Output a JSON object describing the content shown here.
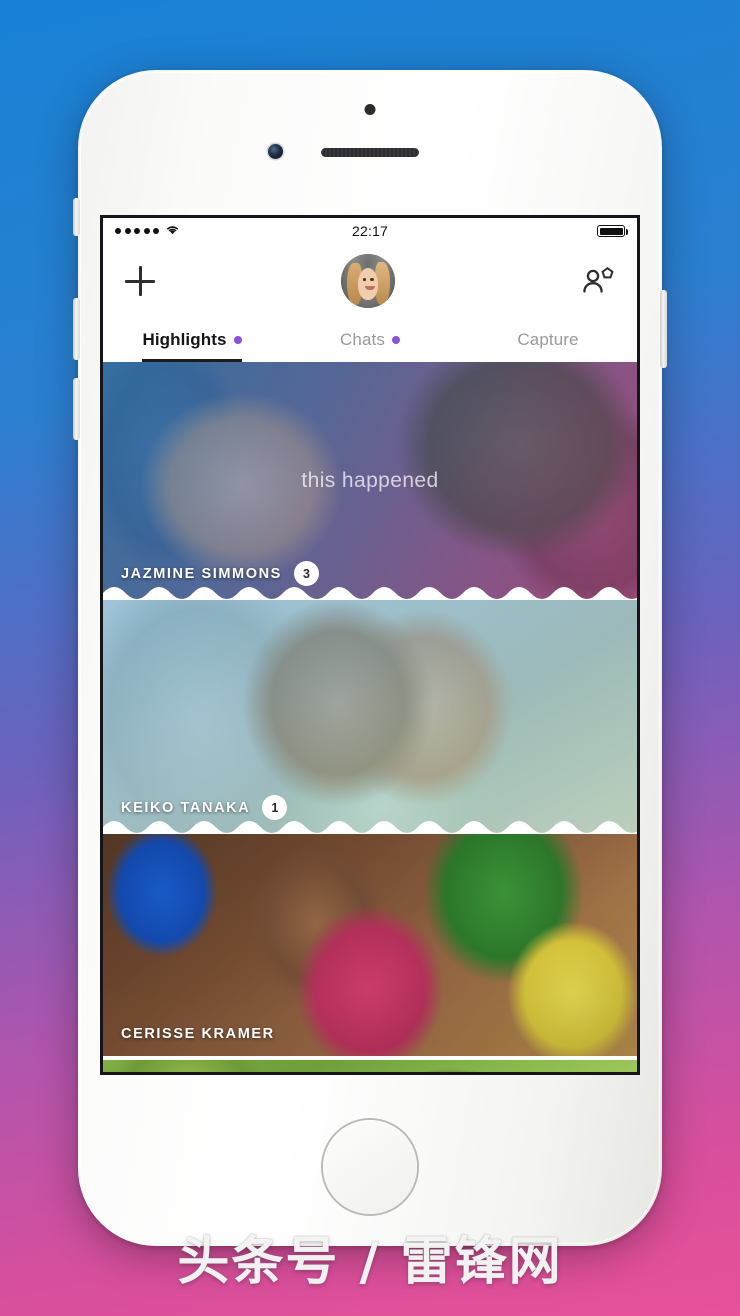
{
  "background": {
    "gradient_top": "#1982d6",
    "gradient_mid": "#6a62bd",
    "gradient_bottom": "#e8509a"
  },
  "watermark": {
    "text": "头条号 / 雷锋网"
  },
  "phone": {
    "device": "white-iphone",
    "hardware": {
      "earpiece": "speaker-grille",
      "front_camera": "camera-icon",
      "proximity_sensor": "sensor-dot",
      "home_button": "home-button"
    }
  },
  "statusbar": {
    "signal_dots": 5,
    "wifi_icon": "wifi-icon",
    "time": "22:17",
    "battery_icon": "battery-full-icon"
  },
  "navbar": {
    "add_label": "+",
    "add_icon": "plus-icon",
    "avatar_icon": "user-avatar",
    "friends_icon": "add-friend-icon"
  },
  "tabs": [
    {
      "label": "Highlights",
      "active": true,
      "has_dot": true,
      "dot_color": "#8c4fd8"
    },
    {
      "label": "Chats",
      "active": false,
      "has_dot": true,
      "dot_color": "#8c4fd8"
    },
    {
      "label": "Capture",
      "active": false,
      "has_dot": false,
      "dot_color": ""
    }
  ],
  "feed": {
    "overlay_text": "this happened",
    "cards": [
      {
        "name": "JAZMINE SIMMONS",
        "count": "3",
        "has_badge": true
      },
      {
        "name": "KEIKO TANAKA",
        "count": "1",
        "has_badge": true
      },
      {
        "name": "CERISSE KRAMER",
        "count": "",
        "has_badge": false
      },
      {
        "name": "",
        "count": "",
        "has_badge": false
      }
    ]
  }
}
